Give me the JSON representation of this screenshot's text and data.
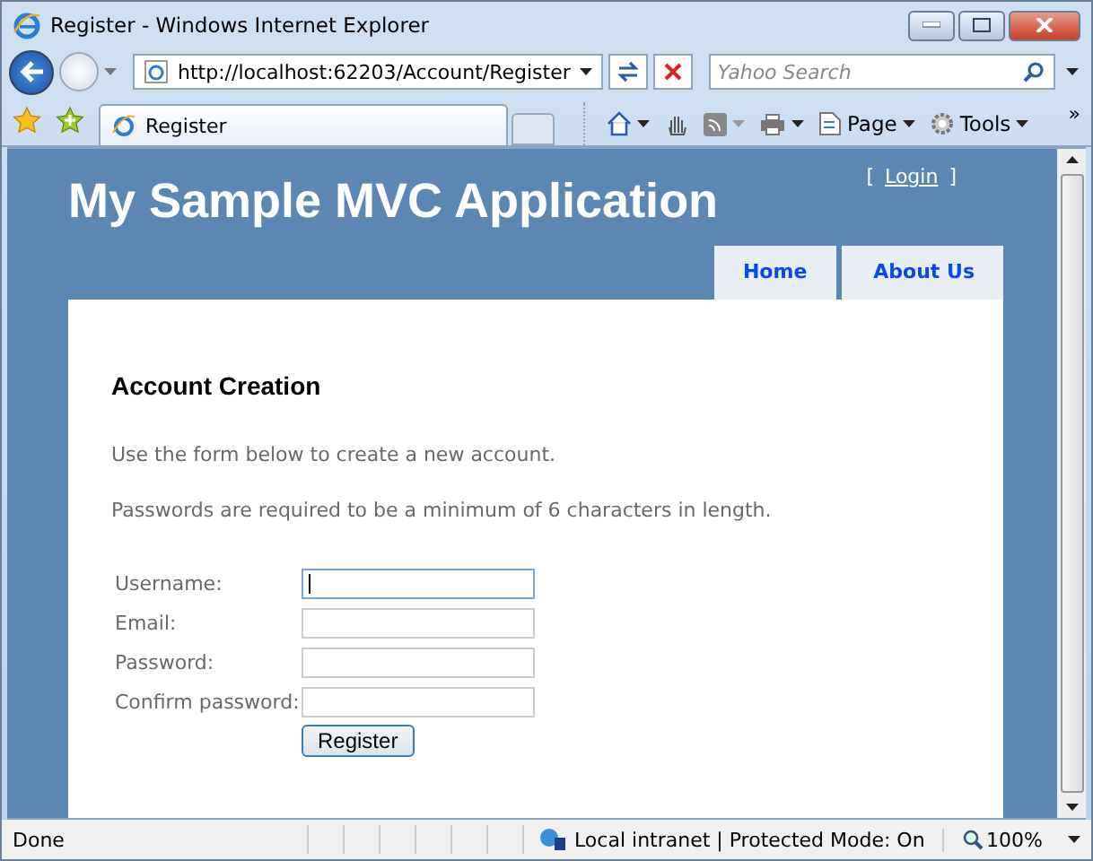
{
  "window": {
    "title": "Register - Windows Internet Explorer"
  },
  "address_bar": {
    "url": "http://localhost:62203/Account/Register"
  },
  "search": {
    "placeholder": "Yahoo Search"
  },
  "tabs": [
    {
      "label": "Register",
      "selected": true
    }
  ],
  "command_bar": {
    "menus": [
      {
        "label": "Page"
      },
      {
        "label": "Tools"
      }
    ],
    "overflow": "»"
  },
  "page": {
    "site_title": "My Sample MVC Application",
    "login_link": "Login",
    "login_brackets": [
      "[",
      "]"
    ],
    "menu": [
      {
        "label": "Home"
      },
      {
        "label": "About Us"
      }
    ],
    "heading": "Account Creation",
    "paragraphs": [
      "Use the form below to create a new account.",
      "Passwords are required to be a minimum of 6 characters in length."
    ],
    "fields": [
      {
        "label": "Username:",
        "focused": true
      },
      {
        "label": "Email:",
        "focused": false
      },
      {
        "label": "Password:",
        "focused": false
      },
      {
        "label": "Confirm password:",
        "focused": false
      }
    ],
    "submit": "Register"
  },
  "status_bar": {
    "text": "Done",
    "zone": "Local intranet | Protected Mode: On",
    "zoom": "100%"
  }
}
